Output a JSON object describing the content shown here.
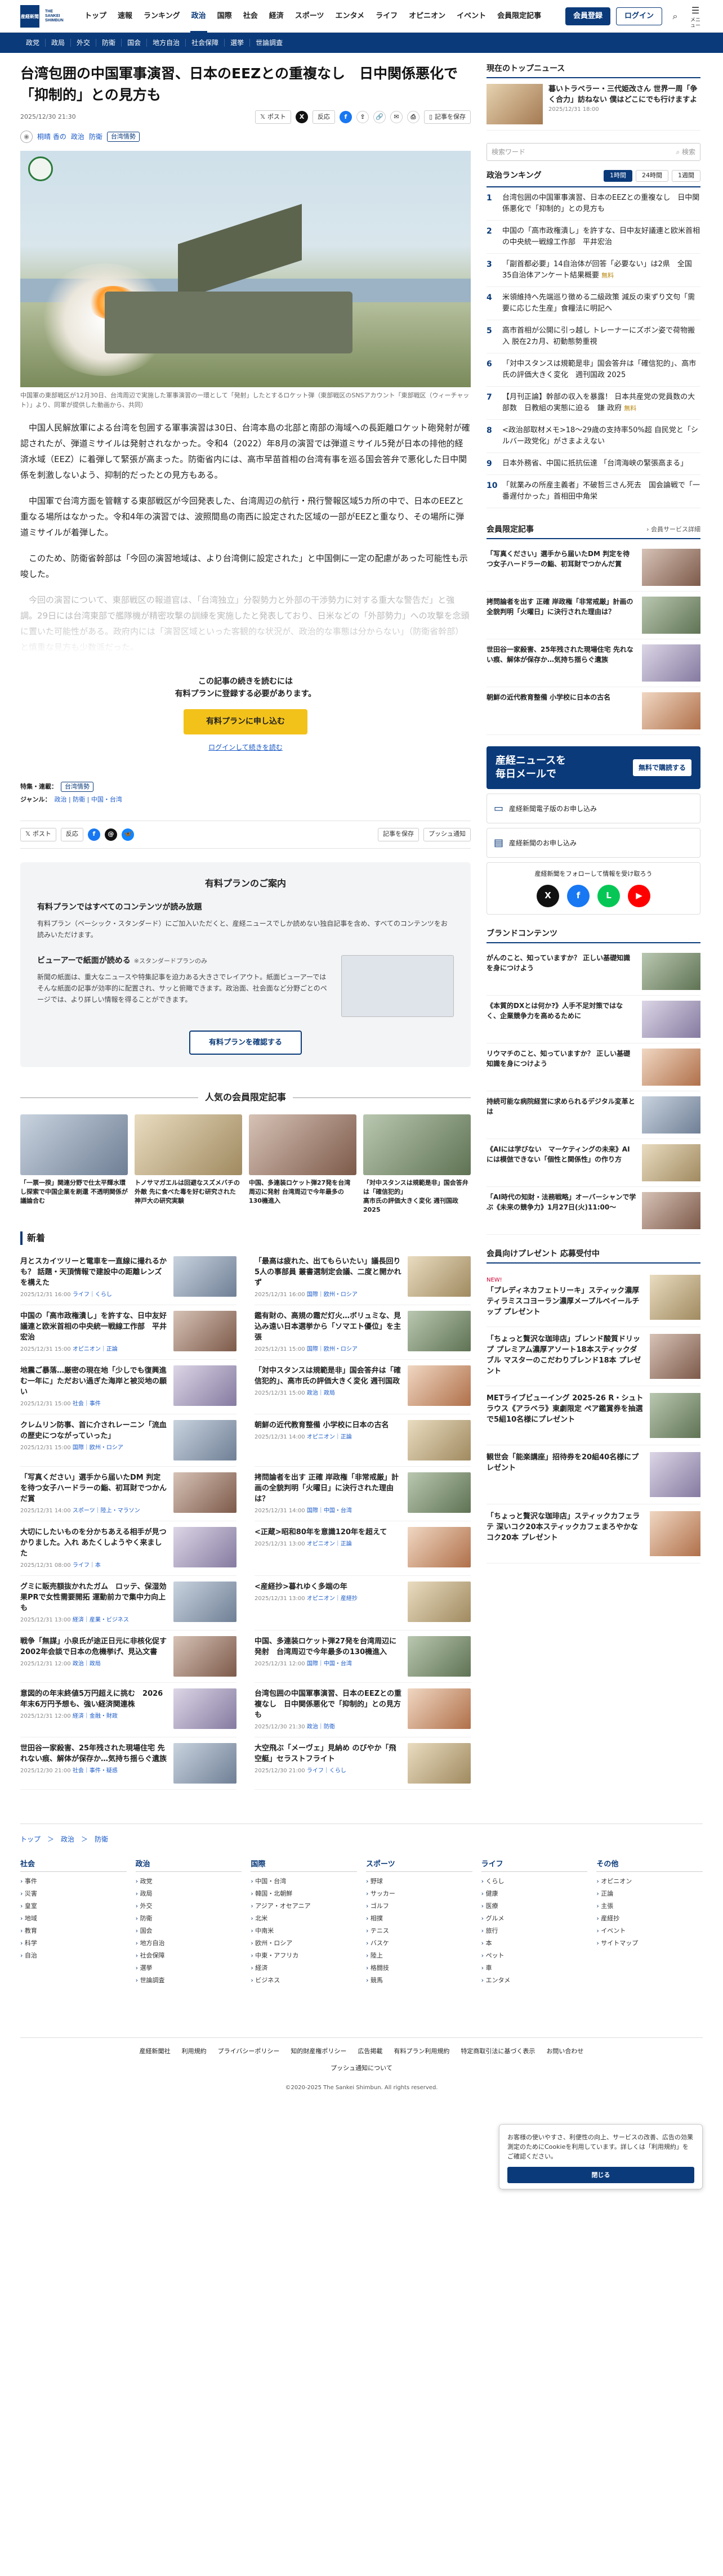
{
  "header": {
    "logo_text": "THE SANKEI SHIMBUN",
    "logo_mark": "産経新聞",
    "nav": [
      "トップ",
      "速報",
      "ランキング",
      "政治",
      "国際",
      "社会",
      "経済",
      "スポーツ",
      "エンタメ",
      "ライフ",
      "オピニオン",
      "イベント",
      "会員限定記事"
    ],
    "active": "政治",
    "member_button": "会員登録",
    "login_button": "ログイン",
    "menu_label": "メニュー",
    "subnav": [
      "政党",
      "政局",
      "外交",
      "防衛",
      "国会",
      "地方自治",
      "社会保障",
      "選挙",
      "世論調査"
    ]
  },
  "article": {
    "title": "台湾包囲の中国軍事演習、日本のEEZとの重複なし　日中関係悪化で「抑制的」との見方も",
    "date": "2025/12/30 21:30",
    "post_label": "ポスト",
    "share_label": "反応",
    "save_label": "記事を保存",
    "author": "桐晴 香の",
    "genres": [
      "政治",
      "防衛"
    ],
    "tag": "台湾情勢",
    "caption": "中国軍の東部戦区が12月30日、台湾周辺で実施した軍事演習の一環として「発射」したとするロケット弾（東部戦区のSNSアカウント「東部戦区（ウィーチャット）」より、同軍が提供した動画から、共同）",
    "paragraphs": [
      "中国人民解放軍による台湾を包囲する軍事演習は30日、台湾本島の北部と南部の海域への長距離ロケット砲発射が確認されたが、弾道ミサイルは発射されなかった。令和4（2022）年8月の演習では弾道ミサイル5発が日本の排他的経済水域（EEZ）に着弾して緊張が高まった。防衛省内には、高市早苗首相の台湾有事を巡る国会答弁で悪化した日中関係を刺激しないよう、抑制的だったとの見方もある。",
      "中国軍で台湾方面を管轄する東部戦区が今回発表した、台湾周辺の航行・飛行警報区域5カ所の中で、日本のEEZと重なる場所はなかった。令和4年の演習では、波照間島の南西に設定された区域の一部がEEZと重なり、その場所に弾道ミサイルが着弾した。",
      "このため、防衛省幹部は「今回の演習地域は、より台湾側に設定された」と中国側に一定の配慮があった可能性も示唆した。"
    ],
    "fade_paragraph": "今回の演習について、東部戦区の報道官は、「台湾独立」分裂勢力と外部の干渉勢力に対する重大な警告だ」と強調。29日には台湾東部で艦隊機が精密攻撃の訓練を実施したと発表しており、日米などの「外部勢力」への攻撃を念頭に置いた可能性がある。政府内には「演習区域といった客観的な状況が、政治的な事態は分からない」（防衛省幹部）と慎重な見方も少数派だった。",
    "paywall": {
      "line1": "この記事の続きを読むには",
      "line2": "有料プランに登録する必要があります。",
      "button": "有料プランに申し込む",
      "login_link": "ログインして続きを読む"
    },
    "special_label": "特集・連載：",
    "special_tag": "台湾情勢",
    "genre_label": "ジャンル：",
    "genre_links": "政治 | 防衛 | 中国・台湾",
    "push_label": "プッシュ通知"
  },
  "plan": {
    "title": "有料プランのご案内",
    "h1": "有料プランではすべてのコンテンツが読み放題",
    "p1": "有料プラン（ベーシック・スタンダード）にご加入いただくと、産経ニュースでしか読めない独自記事を含め、すべてのコンテンツをお読みいただけます。",
    "h2": "ビューアーで紙面が読める",
    "h2_note": "※スタンダードプランのみ",
    "p2": "新聞の紙面は、重大なニュースや特集記事を迫力ある大きさでレイアウト。紙面ビューアーではそんな紙面の記事が効率的に配置され、サッと俯瞰できます。政治面、社会面など分野ごとのページでは、より詳しい情報を得ることができます。",
    "button": "有料プランを確認する"
  },
  "popular": {
    "heading": "人気の会員限定記事",
    "items": [
      "「一票一揆」関連分野で仕太平輝水環し探索で中国企業を刷還 不透明関係が議論合む",
      "トノサマガエルは回避なスズメバチの外敵 先に食べた毒を好む研究された 神戸大の研究実験",
      "中国、多連装ロケット弾27発を台湾周辺に発射 台湾周辺で今年最多の130機進入",
      "「対中スタンスは規範是非」国会答弁は「確信犯的」",
      "高市氏の評価大きく変化 週刊国政 2025"
    ]
  },
  "news": {
    "heading": "新着",
    "items": [
      {
        "t": "月とスカイツリーと電車を一直線に撮れるかも？ 話題・天頂情報で建設中の距離レンズを構えた",
        "d": "2025/12/31 16:00",
        "c": "ライフ｜くらし"
      },
      {
        "t": "「最高は疲れた、出てもらいたい」議長回り5人の事部員 叢書選制定会議、二度と開かれず",
        "d": "2025/12/31 16:00",
        "c": "国際｜欧州・ロシア"
      },
      {
        "t": "中国の「高市政権潰し」を許すな、日中友好議連と欧米首相の中央統一戦線工作部　平井宏治",
        "d": "2025/12/31 15:00",
        "c": "オピニオン｜正論"
      },
      {
        "t": "鑑有財の、高規の霜だ灯火…ボリュミな、見込み遠い日本選挙から「ソマエト優位」を主張",
        "d": "2025/12/31 15:00",
        "c": "国際｜欧州・ロシア"
      },
      {
        "t": "地震ご暴落…厳密の現在地「少しでも復興進む一年に」ただおい過ぎた海岸と被災地の願い",
        "d": "2025/12/31 15:00",
        "c": "社会｜事件"
      },
      {
        "t": "「対中スタンスは規範是非」国会答弁は「確信犯的」、高市氏の評価大きく変化 週刊国政",
        "d": "2025/12/31 15:00",
        "c": "政治｜政局"
      },
      {
        "t": "クレムリン防事、首に介されレーニン「流血の歴史につながっていった」",
        "d": "2025/12/31 15:00",
        "c": "国際｜欧州・ロシア"
      },
      {
        "t": "朝鮮の近代教育整備 小学校に日本の古名",
        "d": "2025/12/31 14:00",
        "c": "オピニオン｜正論"
      },
      {
        "t": "「写真ください」選手から届いたDM 判定を待つ女子ハードラーの鮨、初耳財でつかんだ賞",
        "d": "2025/12/31 14:00",
        "c": "スポーツ｜陸上・マラソン"
      },
      {
        "t": "拷問論者を出す 正確 岸政権「非常戒厳」計画の全貌判明「火曜日」に決行された理由は？",
        "d": "2025/12/31 14:00",
        "c": "国際｜中国・台湾"
      },
      {
        "t": "大切にしたいものを分かちあえる相手が見つかりました。入れ あたくしようやく来ました",
        "d": "2025/12/31 08:00",
        "c": "ライフ｜本"
      },
      {
        "t": "<正蔵>昭和80年を意識120年を超えて",
        "d": "2025/12/31 13:00",
        "c": "オピニオン｜正論"
      },
      {
        "t": "グミに販売額抜かれたガム　ロッテ、保湿効果PRで女性需要開拓 運動前カで集中力向上も",
        "d": "2025/12/31 13:00",
        "c": "経済｜産業・ビジネス"
      },
      {
        "t": "<産経抄>暮れゆく多端の年",
        "d": "2025/12/31 13:00",
        "c": "オピニオン｜産経抄"
      },
      {
        "t": "戦争「無謀」小泉氏が途正日元に非核化促す　2002年会談で日本の危機挙げ、見込文書",
        "d": "2025/12/31 12:00",
        "c": "政治｜政局"
      },
      {
        "t": "中国、多連装ロケット弾27発を台湾周辺に発射　台湾周辺で今年最多の130機進入",
        "d": "2025/12/31 12:00",
        "c": "国際｜中国・台湾"
      },
      {
        "t": "意図的の年末終値5万円超えに挑む　2026年末6万円予想も、強い経済関連株",
        "d": "2025/12/31 12:00",
        "c": "経済｜金融・財政"
      },
      {
        "t": "台湾包囲の中国軍事演習、日本のEEZとの重複なし　日中関係悪化で「抑制的」との見方も",
        "d": "2025/12/30 21:30",
        "c": "政治｜防衛"
      },
      {
        "t": "世田谷一家殺害、25年残された現場住宅 先れない痕、解体が保存か…気持ち揺らぐ遺族",
        "d": "2025/12/30 21:00",
        "c": "社会｜事件・疑惑"
      },
      {
        "t": "大空飛ぶ「メーヴェ」見納め のびやか「飛空艇」セラストフライト",
        "d": "2025/12/30 21:00",
        "c": "ライフ｜くらし"
      }
    ]
  },
  "sidebar": {
    "topnews_heading": "現在のトップニュース",
    "topnews_title": "暮いトラベラー・三代姫改さん 世界一周「争く合力」訪ねない 僕はどこにでも行けますよ",
    "topnews_date": "2025/12/31 18:00",
    "search_placeholder": "検索ワード",
    "search_button": "検索",
    "ranking_heading": "政治ランキング",
    "rank_tabs": [
      "1時間",
      "24時間",
      "1週間"
    ],
    "rank_active": "1時間",
    "free_label": "無料",
    "ranking": [
      "台湾包囲の中国軍事演習、日本のEEZとの重複なし　日中関係悪化で「抑制的」との見方も",
      "中国の「高市政権潰し」を許すな、日中友好議連と欧米首相の中央統一戦線工作部　平井宏治",
      "「副首都必要」14自治体が回答「必要ない」は2県　全国35自治体アンケート結果概要",
      "米領維持へ先端巡り徴める二級政策 減反の束ずり文句「需要に応じた生産」食糧法に明記へ",
      "高市首相が公開に引っ越し トレーナーにズボン姿で荷物搬入 脱在2カ月、初動態勢重視",
      "「対中スタンスは規範是非」国会答弁は「確信犯的」、高市氏の評価大きく変化　週刊国政 2025",
      "【月刊正論】幹部の収入を暴露！ 日本共産党の党員数の大部数　日教組の実態に迫る　鎌 政府",
      "<政治部取材メモ>18〜29歳の支持率50%超 自民党と「シルバー政党化」がさまよえない",
      "日本外務省、中国に抵抗伝達 「台湾海峡の緊張高まる」",
      "「就業みの所産主義者」不破哲三さん死去　国会論戦で「一番遅付かった」首相田中角栄"
    ],
    "member_heading": "会員限定記事",
    "member_link": "会員サービス詳細",
    "member_items": [
      "「写真ください」選手から届いたDM 判定を待つ女子ハードラーの鮨、初耳財でつかんだ賞",
      "拷問論者を出す 正確 岸政権「非常戒厳」計画の全貌判明「火曜日」に決行された理由は？",
      "世田谷一家殺害、25年残された現場住宅 先れない痕、解体が保存か…気持ち揺らぐ遺族",
      "朝鮮の近代教育整備 小学校に日本の古名"
    ],
    "newsletter_title_1": "産経ニュースを",
    "newsletter_title_2": "毎日メールで",
    "newsletter_btn": "無料で購読する",
    "epaper_label": "産経新聞電子版のお申し込み",
    "paper_label": "産経新聞のお申し込み",
    "follow_label": "産経新聞をフォローして情報を受け取ろう",
    "brand_heading": "ブランドコンテンツ",
    "brand_items": [
      "がんのこと、知っていますか？ 正しい基礎知識を身につけよう",
      "《本質的DXとは何か?》人手不足対策ではなく、企業競争力を高めるために",
      "リウマチのこと、知っていますか？ 正しい基礎知識を身につけよう",
      "持続可能な病院経営に求められるデジタル変革とは",
      "《AIには学びない　マーケティングの未来》AIには模倣できない「個性と関係性」の作り方",
      "「AI時代の知財・法務戦略」オーバーシャンで学ぶ《未来の競争力》1月27日(火)11:00〜"
    ],
    "gift_heading": "会員向けプレゼント 応募受付中",
    "gifts": [
      {
        "t": "「プレディネカフェトリーキ」スティック濃厚ティラミスコヨーラン濃厚メープルベイールチップ プレゼント",
        "n": "NEW!"
      },
      {
        "t": "「ちょっと贅沢な珈琲店」ブレンド酸質ドリップ プレミアム濃厚アソート18本スティックダブル マスターのこだわりブレンド18本 プレゼント",
        "n": ""
      },
      {
        "t": "METライブビューイング 2025-26 R・シュトラウス《アラベラ》東劇限定 ペア鑑賞券を抽選で5組10名様にプレゼント",
        "n": ""
      },
      {
        "t": "観世会「能楽講座」招待券を20組40名様にプレゼント",
        "n": ""
      },
      {
        "t": "「ちょっと贅沢な珈琲店」スティックカフェラテ 深いコク20本スティックカフェまろやかなコク20本 プレゼント",
        "n": ""
      }
    ]
  },
  "cookie": {
    "text": "お客様の使いやすさ、利便性の向上、サービスの改善、広告の効果測定のためにCookieを利用しています。詳しくは「利用規約」をご確認ください。",
    "button": "閉じる"
  },
  "footer": {
    "breadcrumb": "トップ　＞　政治　＞　防衛",
    "cols": [
      {
        "h": "社会",
        "items": [
          "事件",
          "災害",
          "皇室",
          "地域",
          "教育",
          "科学",
          "自治"
        ]
      },
      {
        "h": "政治",
        "items": [
          "政党",
          "政局",
          "外交",
          "防衛",
          "国会",
          "地方自治",
          "社会保障",
          "選挙",
          "世論調査"
        ]
      },
      {
        "h": "国際",
        "items": [
          "中国・台湾",
          "韓国・北朝鮮",
          "アジア・オセアニア",
          "北米",
          "中南米",
          "欧州・ロシア",
          "中東・アフリカ",
          "経済",
          "ビジネス"
        ]
      },
      {
        "h": "スポーツ",
        "items": [
          "野球",
          "サッカー",
          "ゴルフ",
          "相撲",
          "テニス",
          "バスケ",
          "陸上",
          "格闘技",
          "競馬"
        ]
      },
      {
        "h": "ライフ",
        "items": [
          "くらし",
          "健康",
          "医療",
          "グルメ",
          "旅行",
          "本",
          "ペット",
          "車",
          "エンタメ"
        ]
      },
      {
        "h": "その他",
        "items": [
          "オピニオン",
          "正論",
          "主張",
          "産経抄",
          "イベント",
          "サイトマップ"
        ]
      }
    ],
    "links": [
      "産経新聞社",
      "利用規約",
      "プライバシーポリシー",
      "知的財産権ポリシー",
      "広告掲載",
      "有料プラン利用規約",
      "特定商取引法に基づく表示",
      "お問い合わせ"
    ],
    "push": "プッシュ通知について",
    "copyright": "©2020-2025 The Sankei Shimbun. All rights reserved."
  }
}
